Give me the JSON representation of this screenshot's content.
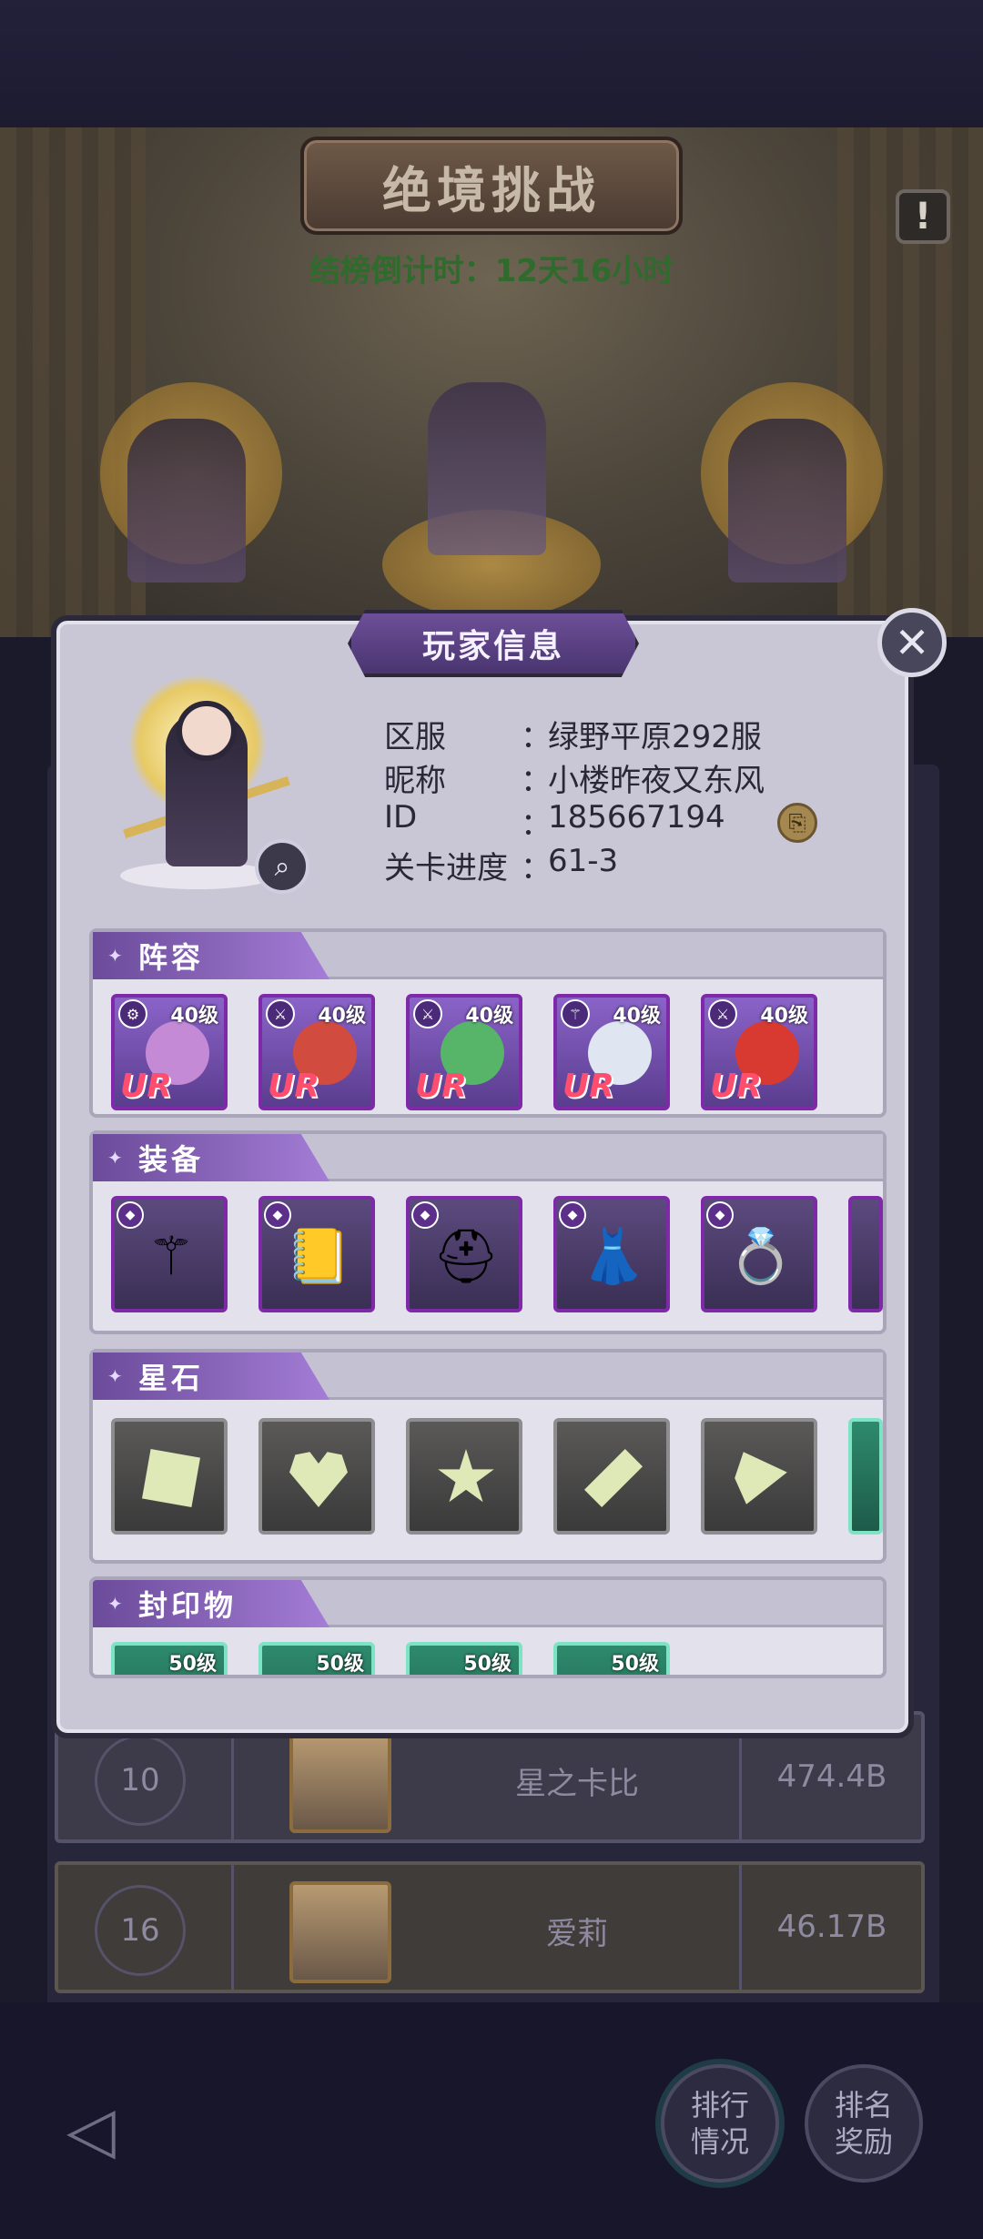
{
  "page": {
    "title": "绝境挑战",
    "countdown": "结榜倒计时：12天16小时",
    "alert_icon": "exclamation-icon"
  },
  "ranking": [
    {
      "rank": "10",
      "name": "星之卡比",
      "score": "474.4B"
    },
    {
      "rank": "16",
      "name": "爱莉",
      "score": "46.17B"
    }
  ],
  "bottom_buttons": {
    "ranking_status": "排行\n情况",
    "ranking_rewards": "排名\n奖励"
  },
  "modal": {
    "title": "玩家信息",
    "close_icon": "close-icon",
    "info": {
      "server_label": "区服",
      "server_value": "绿野平原292服",
      "nickname_label": "昵称",
      "nickname_value": "小楼昨夜又东风",
      "id_label": "ID",
      "id_value": "185667194",
      "progress_label": "关卡进度",
      "progress_value": "61-3"
    },
    "sections": {
      "lineup": "阵容",
      "equipment": "装备",
      "starstone": "星石",
      "seal": "封印物"
    },
    "lineup": [
      {
        "level": "40级",
        "rarity": "UR",
        "class_icon": "gear-icon",
        "color": "#c48ad6"
      },
      {
        "level": "40级",
        "rarity": "UR",
        "class_icon": "sword-icon",
        "color": "#d14b3f"
      },
      {
        "level": "40级",
        "rarity": "UR",
        "class_icon": "sword-icon",
        "color": "#57b56a"
      },
      {
        "level": "40级",
        "rarity": "UR",
        "class_icon": "staff-icon",
        "color": "#dfe6f2"
      },
      {
        "level": "40级",
        "rarity": "UR",
        "class_icon": "sword-icon",
        "color": "#d83a32"
      }
    ],
    "equipment": [
      {
        "icon": "scepter-icon",
        "glyph": "⚚"
      },
      {
        "icon": "book-icon",
        "glyph": "📒"
      },
      {
        "icon": "helmet-icon",
        "glyph": "⛑"
      },
      {
        "icon": "skirt-icon",
        "glyph": "👗"
      },
      {
        "icon": "ring-icon",
        "glyph": "💍"
      }
    ],
    "starstones": [
      {
        "shape": "square-gem-icon"
      },
      {
        "shape": "heart-gem-icon"
      },
      {
        "shape": "star-gem-icon"
      },
      {
        "shape": "diamond-gem-icon"
      },
      {
        "shape": "triangle-gem-icon"
      }
    ],
    "seals": [
      {
        "level": "50级"
      },
      {
        "level": "50级"
      },
      {
        "level": "50级"
      },
      {
        "level": "50级"
      }
    ]
  }
}
